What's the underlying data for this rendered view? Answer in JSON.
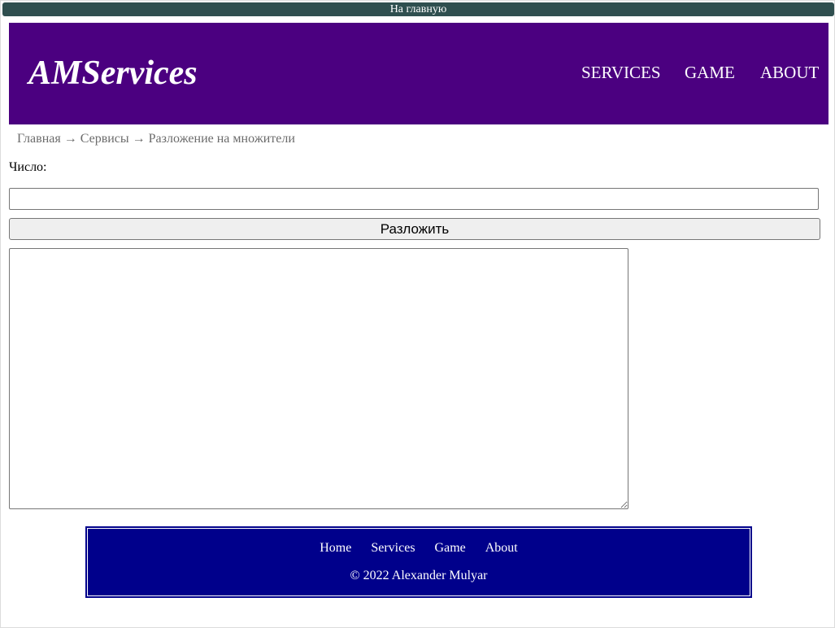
{
  "top_bar": {
    "home_label": "На главную"
  },
  "header": {
    "logo": "AMServices",
    "nav": [
      {
        "label": "SERVICES"
      },
      {
        "label": "GAME"
      },
      {
        "label": "ABOUT"
      }
    ]
  },
  "breadcrumb": {
    "items": [
      "Главная",
      "Сервисы",
      "Разложение на множители"
    ],
    "separator": "→"
  },
  "form": {
    "number_label": "Число:",
    "number_value": "",
    "number_placeholder": "",
    "submit_label": "Разложить",
    "result_value": ""
  },
  "footer": {
    "links": [
      {
        "label": "Home"
      },
      {
        "label": "Services"
      },
      {
        "label": "Game"
      },
      {
        "label": "About"
      }
    ],
    "copyright": "© 2022 Alexander Mulyar"
  },
  "colors": {
    "top_bar_bg": "#2f4f4f",
    "header_bg": "#4b0080",
    "footer_bg": "#00008b",
    "breadcrumb_text": "#6b6b6b"
  }
}
